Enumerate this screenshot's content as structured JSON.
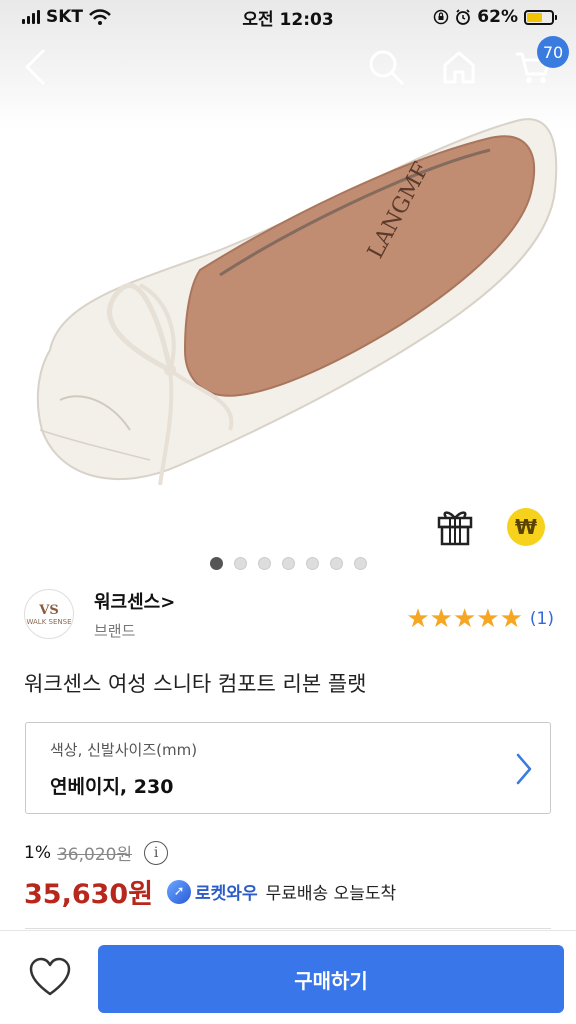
{
  "status_bar": {
    "carrier": "SKT",
    "time": "오전 12:03",
    "battery": "62%",
    "battery_level": 0.62,
    "wifi_icon": "wifi-icon",
    "icons": [
      "rotation-lock-icon",
      "alarm-icon"
    ]
  },
  "header": {
    "back_icon": "chevron-left-icon",
    "search_icon": "search-icon",
    "home_icon": "home-icon",
    "cart_icon": "cart-icon",
    "cart_count": "70"
  },
  "product_image": {
    "description_icon": "ballet-flat-shoe-image",
    "insole_text": "LANGMF"
  },
  "image_actions": {
    "gift_icon": "gift-icon",
    "coin_icon": "won-coin-icon",
    "coin_symbol": "₩"
  },
  "carousel": {
    "total": 7,
    "active": 0
  },
  "brand": {
    "logo_text": "VS",
    "logo_sub": "WALK SENSE",
    "name": "워크센스>",
    "sub": "브랜드"
  },
  "rating": {
    "stars": 5,
    "review_count": "(1)"
  },
  "product": {
    "title": "워크센스 여성 스니타 컴포트 리본 플랫"
  },
  "option": {
    "label": "색상, 신발사이즈(mm)",
    "value": "연베이지, 230"
  },
  "pricing": {
    "discount": "1%",
    "original_price": "36,020원",
    "info_symbol": "i",
    "price": "35,630원",
    "rocket_label": "로켓와우",
    "delivery": "무료배송 오늘도착"
  },
  "bottom_bar": {
    "heart_icon": "heart-icon",
    "buy_label": "구매하기"
  },
  "colors": {
    "accent": "#3876e9",
    "price": "#b8271c",
    "star": "#f5a623",
    "rocket": "#2c5cc7"
  }
}
